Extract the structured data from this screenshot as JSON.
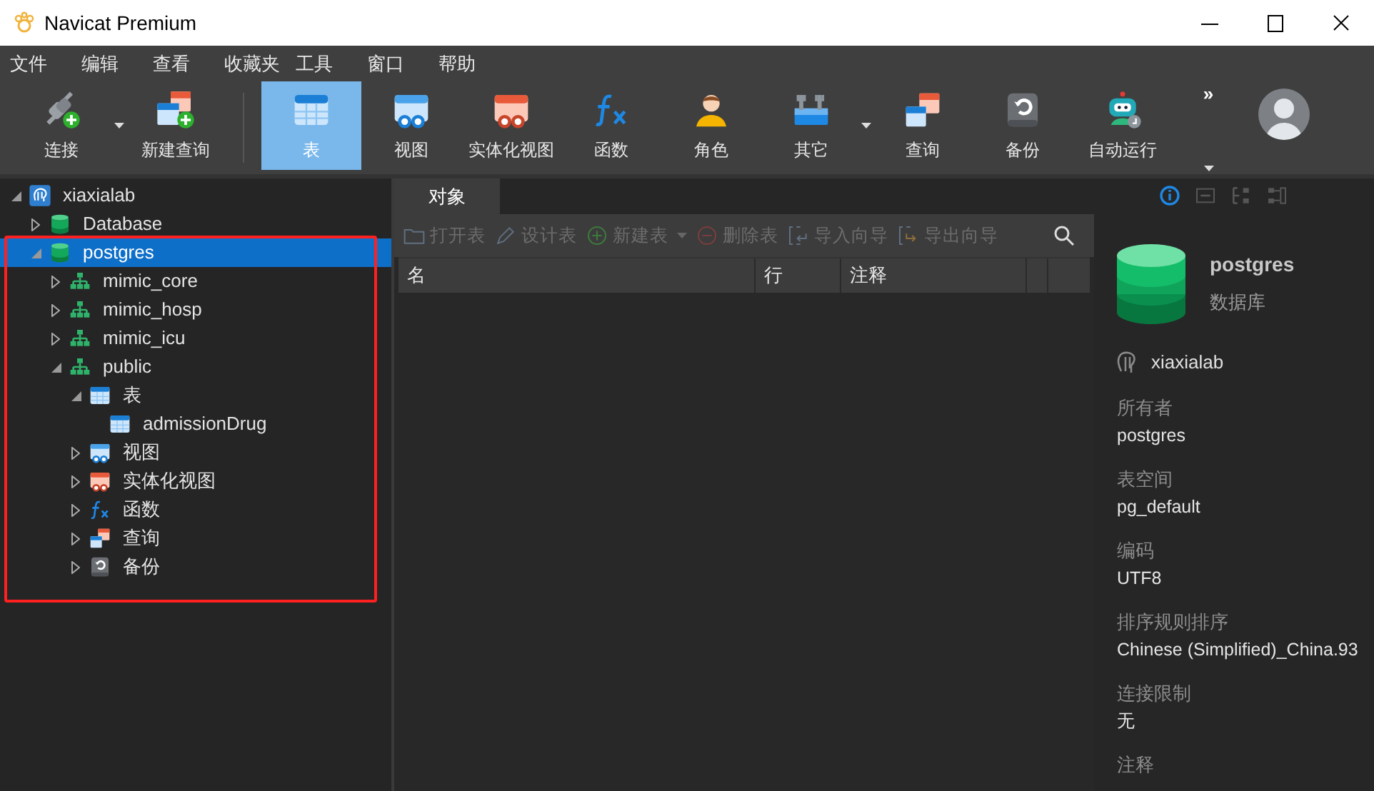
{
  "window": {
    "title": "Navicat Premium"
  },
  "menu": [
    "文件",
    "编辑",
    "查看",
    "收藏夹",
    "工具",
    "窗口",
    "帮助"
  ],
  "toolbar": {
    "items": [
      {
        "label": "连接",
        "kind": "connect",
        "selected": false,
        "dropdown": true
      },
      {
        "label": "新建查询",
        "kind": "newquery",
        "selected": false,
        "dropdown": false
      },
      {
        "label": "表",
        "kind": "table",
        "selected": true,
        "dropdown": false
      },
      {
        "label": "视图",
        "kind": "view",
        "selected": false,
        "dropdown": false
      },
      {
        "label": "实体化视图",
        "kind": "matview",
        "selected": false,
        "dropdown": false
      },
      {
        "label": "函数",
        "kind": "function",
        "selected": false,
        "dropdown": false
      },
      {
        "label": "角色",
        "kind": "role",
        "selected": false,
        "dropdown": false
      },
      {
        "label": "其它",
        "kind": "tools",
        "selected": false,
        "dropdown": true
      },
      {
        "label": "查询",
        "kind": "query",
        "selected": false,
        "dropdown": false
      },
      {
        "label": "备份",
        "kind": "backup",
        "selected": false,
        "dropdown": false
      },
      {
        "label": "自动运行",
        "kind": "robot",
        "selected": false,
        "dropdown": false
      }
    ],
    "overflow": "»"
  },
  "tree": [
    {
      "label": "xiaxialab",
      "kind": "server",
      "expanded": true,
      "selected": false,
      "children": [
        {
          "label": "Database",
          "kind": "db",
          "expanded": false,
          "selected": false
        },
        {
          "label": "postgres",
          "kind": "db",
          "expanded": true,
          "selected": true,
          "children": [
            {
              "label": "mimic_core",
              "kind": "schema",
              "expanded": false,
              "selected": false
            },
            {
              "label": "mimic_hosp",
              "kind": "schema",
              "expanded": false,
              "selected": false
            },
            {
              "label": "mimic_icu",
              "kind": "schema",
              "expanded": false,
              "selected": false
            },
            {
              "label": "public",
              "kind": "schema",
              "expanded": true,
              "selected": false,
              "children": [
                {
                  "label": "表",
                  "kind": "table",
                  "expanded": true,
                  "selected": false,
                  "children": [
                    {
                      "label": "admissionDrug",
                      "kind": "table",
                      "selected": false
                    }
                  ]
                },
                {
                  "label": "视图",
                  "kind": "view",
                  "expanded": false,
                  "selected": false
                },
                {
                  "label": "实体化视图",
                  "kind": "matview",
                  "expanded": false,
                  "selected": false
                },
                {
                  "label": "函数",
                  "kind": "function",
                  "expanded": false,
                  "selected": false
                },
                {
                  "label": "查询",
                  "kind": "query",
                  "expanded": false,
                  "selected": false
                },
                {
                  "label": "备份",
                  "kind": "backup",
                  "expanded": false,
                  "selected": false
                }
              ]
            }
          ]
        }
      ]
    }
  ],
  "objects": {
    "tabs": [
      {
        "label": "对象",
        "selected": true
      }
    ],
    "actions": [
      {
        "label": "打开表",
        "kind": "folder",
        "disabled": true,
        "dropdown": false
      },
      {
        "label": "设计表",
        "kind": "pencil",
        "disabled": true,
        "dropdown": false
      },
      {
        "label": "新建表",
        "kind": "plus",
        "disabled": true,
        "dropdown": true
      },
      {
        "label": "删除表",
        "kind": "minus",
        "disabled": true,
        "dropdown": false
      },
      {
        "label": "导入向导",
        "kind": "import",
        "disabled": true,
        "dropdown": false
      },
      {
        "label": "导出向导",
        "kind": "export",
        "disabled": true,
        "dropdown": false
      }
    ],
    "columns": [
      "名",
      "行",
      "注释"
    ]
  },
  "info": {
    "tabs": [
      {
        "kind": "info",
        "selected": true
      },
      {
        "kind": "ddl",
        "selected": false
      },
      {
        "kind": "deps",
        "selected": false
      },
      {
        "kind": "compare",
        "selected": false
      }
    ],
    "name": "postgres",
    "type": "数据库",
    "connection": "xiaxialab",
    "fields": [
      {
        "label": "所有者",
        "value": "postgres"
      },
      {
        "label": "表空间",
        "value": "pg_default"
      },
      {
        "label": "编码",
        "value": "UTF8"
      },
      {
        "label": "排序规则排序",
        "value": "Chinese (Simplified)_China.93"
      },
      {
        "label": "连接限制",
        "value": "无"
      },
      {
        "label": "注释"
      }
    ]
  }
}
